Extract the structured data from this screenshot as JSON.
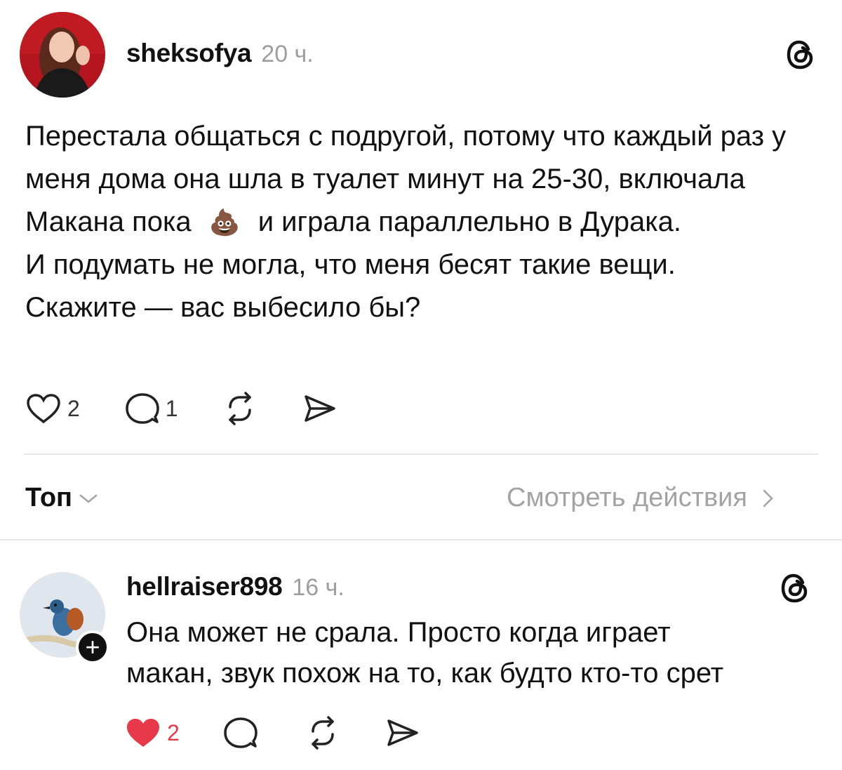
{
  "post": {
    "username": "sheksofya",
    "time": "20 ч.",
    "paragraphs": [
      "Перестала общаться с подругой, потому что каждый раз у меня дома она шла в туалет минут на 25-30, включала Макана пока",
      "и играла параллельно в Дурака.",
      "И подумать не могла, что меня бесят такие вещи.",
      "Скажите — вас выбесило бы?"
    ],
    "emoji": "💩",
    "likes": "2",
    "comments": "1"
  },
  "replies_header": {
    "sort_label": "Топ",
    "view_activity": "Смотреть действия"
  },
  "reply": {
    "username": "hellraiser898",
    "time": "16 ч.",
    "text_line1": "Она может не срала. Просто когда играет",
    "text_line2": "макан, звук похож на то, как будто кто-то срет",
    "likes": "2",
    "follow_badge": "+"
  },
  "icons": {
    "threads": "threads-logo-icon",
    "like": "heart-icon",
    "comment": "comment-icon",
    "repost": "repost-icon",
    "share": "send-icon"
  },
  "colors": {
    "like_active": "#e8394b",
    "muted_text": "#9e9e9e"
  }
}
